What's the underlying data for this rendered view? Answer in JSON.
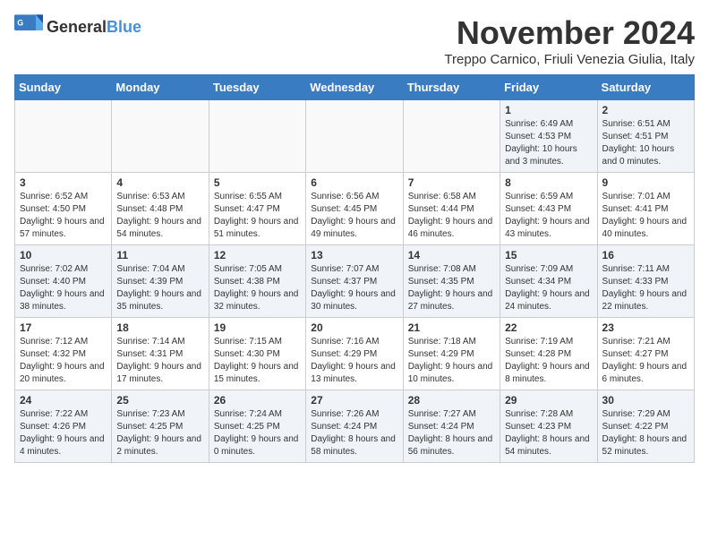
{
  "logo": {
    "general": "General",
    "blue": "Blue"
  },
  "title": "November 2024",
  "subtitle": "Treppo Carnico, Friuli Venezia Giulia, Italy",
  "days_of_week": [
    "Sunday",
    "Monday",
    "Tuesday",
    "Wednesday",
    "Thursday",
    "Friday",
    "Saturday"
  ],
  "weeks": [
    [
      {
        "day": "",
        "info": "",
        "empty": true
      },
      {
        "day": "",
        "info": "",
        "empty": true
      },
      {
        "day": "",
        "info": "",
        "empty": true
      },
      {
        "day": "",
        "info": "",
        "empty": true
      },
      {
        "day": "",
        "info": "",
        "empty": true
      },
      {
        "day": "1",
        "info": "Sunrise: 6:49 AM\nSunset: 4:53 PM\nDaylight: 10 hours\nand 3 minutes."
      },
      {
        "day": "2",
        "info": "Sunrise: 6:51 AM\nSunset: 4:51 PM\nDaylight: 10 hours\nand 0 minutes."
      }
    ],
    [
      {
        "day": "3",
        "info": "Sunrise: 6:52 AM\nSunset: 4:50 PM\nDaylight: 9 hours\nand 57 minutes."
      },
      {
        "day": "4",
        "info": "Sunrise: 6:53 AM\nSunset: 4:48 PM\nDaylight: 9 hours\nand 54 minutes."
      },
      {
        "day": "5",
        "info": "Sunrise: 6:55 AM\nSunset: 4:47 PM\nDaylight: 9 hours\nand 51 minutes."
      },
      {
        "day": "6",
        "info": "Sunrise: 6:56 AM\nSunset: 4:45 PM\nDaylight: 9 hours\nand 49 minutes."
      },
      {
        "day": "7",
        "info": "Sunrise: 6:58 AM\nSunset: 4:44 PM\nDaylight: 9 hours\nand 46 minutes."
      },
      {
        "day": "8",
        "info": "Sunrise: 6:59 AM\nSunset: 4:43 PM\nDaylight: 9 hours\nand 43 minutes."
      },
      {
        "day": "9",
        "info": "Sunrise: 7:01 AM\nSunset: 4:41 PM\nDaylight: 9 hours\nand 40 minutes."
      }
    ],
    [
      {
        "day": "10",
        "info": "Sunrise: 7:02 AM\nSunset: 4:40 PM\nDaylight: 9 hours\nand 38 minutes."
      },
      {
        "day": "11",
        "info": "Sunrise: 7:04 AM\nSunset: 4:39 PM\nDaylight: 9 hours\nand 35 minutes."
      },
      {
        "day": "12",
        "info": "Sunrise: 7:05 AM\nSunset: 4:38 PM\nDaylight: 9 hours\nand 32 minutes."
      },
      {
        "day": "13",
        "info": "Sunrise: 7:07 AM\nSunset: 4:37 PM\nDaylight: 9 hours\nand 30 minutes."
      },
      {
        "day": "14",
        "info": "Sunrise: 7:08 AM\nSunset: 4:35 PM\nDaylight: 9 hours\nand 27 minutes."
      },
      {
        "day": "15",
        "info": "Sunrise: 7:09 AM\nSunset: 4:34 PM\nDaylight: 9 hours\nand 24 minutes."
      },
      {
        "day": "16",
        "info": "Sunrise: 7:11 AM\nSunset: 4:33 PM\nDaylight: 9 hours\nand 22 minutes."
      }
    ],
    [
      {
        "day": "17",
        "info": "Sunrise: 7:12 AM\nSunset: 4:32 PM\nDaylight: 9 hours\nand 20 minutes."
      },
      {
        "day": "18",
        "info": "Sunrise: 7:14 AM\nSunset: 4:31 PM\nDaylight: 9 hours\nand 17 minutes."
      },
      {
        "day": "19",
        "info": "Sunrise: 7:15 AM\nSunset: 4:30 PM\nDaylight: 9 hours\nand 15 minutes."
      },
      {
        "day": "20",
        "info": "Sunrise: 7:16 AM\nSunset: 4:29 PM\nDaylight: 9 hours\nand 13 minutes."
      },
      {
        "day": "21",
        "info": "Sunrise: 7:18 AM\nSunset: 4:29 PM\nDaylight: 9 hours\nand 10 minutes."
      },
      {
        "day": "22",
        "info": "Sunrise: 7:19 AM\nSunset: 4:28 PM\nDaylight: 9 hours\nand 8 minutes."
      },
      {
        "day": "23",
        "info": "Sunrise: 7:21 AM\nSunset: 4:27 PM\nDaylight: 9 hours\nand 6 minutes."
      }
    ],
    [
      {
        "day": "24",
        "info": "Sunrise: 7:22 AM\nSunset: 4:26 PM\nDaylight: 9 hours\nand 4 minutes."
      },
      {
        "day": "25",
        "info": "Sunrise: 7:23 AM\nSunset: 4:25 PM\nDaylight: 9 hours\nand 2 minutes."
      },
      {
        "day": "26",
        "info": "Sunrise: 7:24 AM\nSunset: 4:25 PM\nDaylight: 9 hours\nand 0 minutes."
      },
      {
        "day": "27",
        "info": "Sunrise: 7:26 AM\nSunset: 4:24 PM\nDaylight: 8 hours\nand 58 minutes."
      },
      {
        "day": "28",
        "info": "Sunrise: 7:27 AM\nSunset: 4:24 PM\nDaylight: 8 hours\nand 56 minutes."
      },
      {
        "day": "29",
        "info": "Sunrise: 7:28 AM\nSunset: 4:23 PM\nDaylight: 8 hours\nand 54 minutes."
      },
      {
        "day": "30",
        "info": "Sunrise: 7:29 AM\nSunset: 4:22 PM\nDaylight: 8 hours\nand 52 minutes."
      }
    ]
  ]
}
